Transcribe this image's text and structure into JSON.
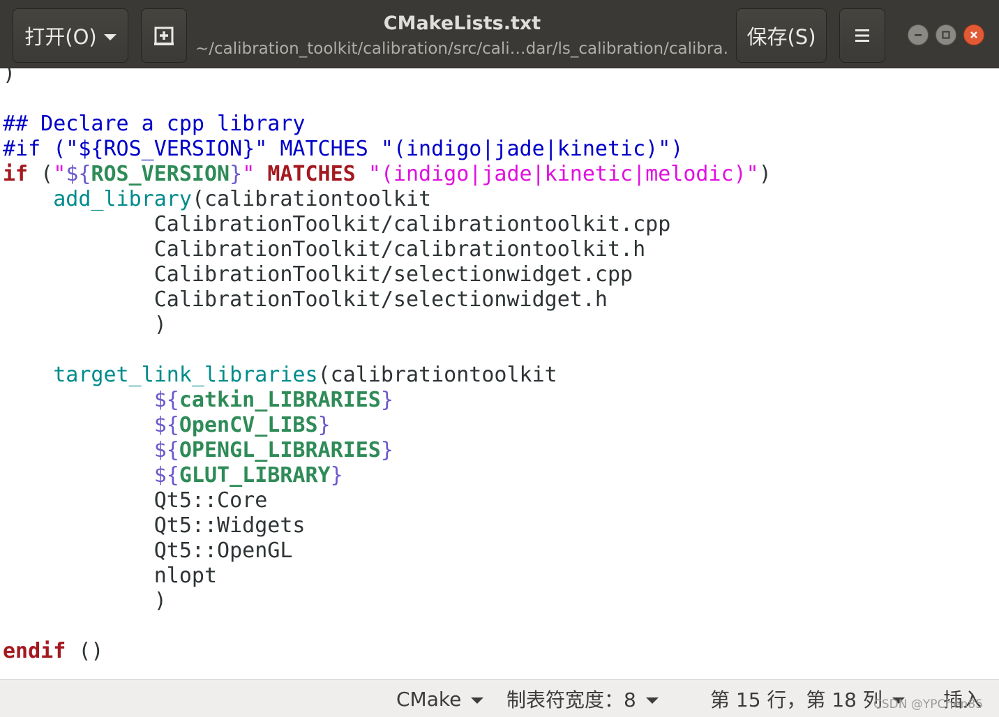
{
  "header": {
    "open_label": "打开(O)",
    "new_tab_icon": "new-document-icon",
    "title": "CMakeLists.txt",
    "path": "~/calibration_toolkit/calibration/src/cali…dar/ls_calibration/calibra…",
    "save_label": "保存(S)",
    "menu_icon": "hamburger-menu-icon",
    "window_controls": [
      "minimize",
      "maximize",
      "close"
    ]
  },
  "editor": {
    "language": "CMake",
    "lines": [
      ")",
      "",
      "## Declare a cpp library",
      "#if (\"${ROS_VERSION}\" MATCHES \"(indigo|jade|kinetic)\")",
      "if (\"${ROS_VERSION}\" MATCHES \"(indigo|jade|kinetic|melodic)\")",
      "    add_library(calibrationtoolkit",
      "            CalibrationToolkit/calibrationtoolkit.cpp",
      "            CalibrationToolkit/calibrationtoolkit.h",
      "            CalibrationToolkit/selectionwidget.cpp",
      "            CalibrationToolkit/selectionwidget.h",
      "            )",
      "",
      "    target_link_libraries(calibrationtoolkit",
      "            ${catkin_LIBRARIES}",
      "            ${OpenCV_LIBS}",
      "            ${OPENGL_LIBRARIES}",
      "            ${GLUT_LIBRARY}",
      "            Qt5::Core",
      "            Qt5::Widgets",
      "            Qt5::OpenGL",
      "            nlopt",
      "            )",
      "",
      "endif ()"
    ],
    "colors": {
      "comment": "#0000c8",
      "keyword": "#a3191f",
      "string": "#e010e0",
      "function": "#008b8b",
      "variable": "#6a5acd",
      "variable_name": "#2e8b57",
      "text": "#2e3436"
    }
  },
  "statusbar": {
    "language": "CMake",
    "tab_width": "制表符宽度：8",
    "position": "第 15 行，第 18 列",
    "mode": "插入"
  },
  "watermark": "CSDN @YPChen85"
}
